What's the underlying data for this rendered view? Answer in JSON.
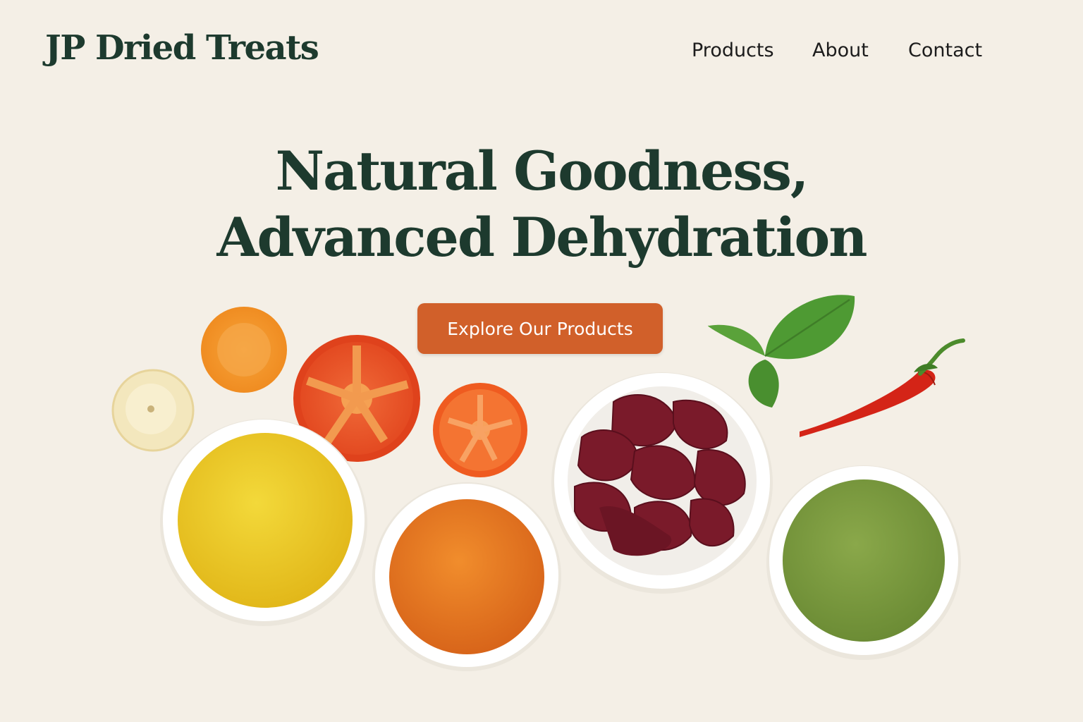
{
  "header": {
    "logo": "JP Dried Treats",
    "nav": [
      {
        "label": "Products"
      },
      {
        "label": "About"
      },
      {
        "label": "Contact"
      }
    ]
  },
  "hero": {
    "title_line1": "Natural Goodness,",
    "title_line2": "Advanced Dehydration",
    "cta_label": "Explore Our Products"
  },
  "colors": {
    "background": "#f4efe6",
    "heading": "#1d3a2e",
    "accent": "#d1602a"
  },
  "ingredients": [
    "banana-slice",
    "carrot-slice",
    "tomato-slice",
    "small-tomato-slice",
    "basil-leaves",
    "red-chili-pepper",
    "yellow-powder-bowl",
    "orange-powder-bowl",
    "dried-beet-chips-bowl",
    "green-powder-bowl"
  ]
}
